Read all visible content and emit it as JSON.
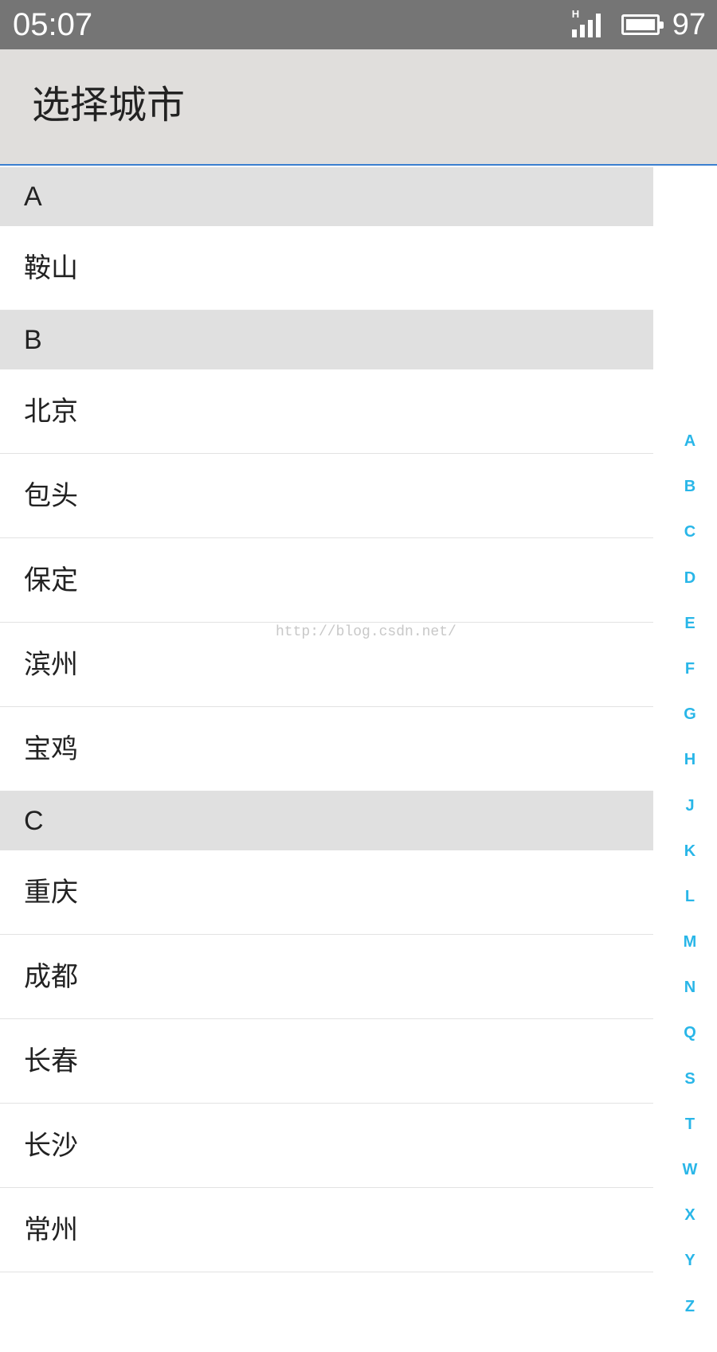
{
  "status_bar": {
    "time": "05:07",
    "network_label": "H",
    "battery_level": "97",
    "signal_icon": "signal-icon",
    "battery_icon": "battery-icon"
  },
  "title_bar": {
    "title": "选择城市",
    "accent_color": "#3b7fd0"
  },
  "city_list": {
    "sections": [
      {
        "letter": "A",
        "cities": [
          "鞍山"
        ]
      },
      {
        "letter": "B",
        "cities": [
          "北京",
          "包头",
          "保定",
          "滨州",
          "宝鸡"
        ]
      },
      {
        "letter": "C",
        "cities": [
          "重庆",
          "成都",
          "长春",
          "长沙",
          "常州"
        ]
      }
    ]
  },
  "index_bar": {
    "letters": [
      "A",
      "B",
      "C",
      "D",
      "E",
      "F",
      "G",
      "H",
      "J",
      "K",
      "L",
      "M",
      "N",
      "Q",
      "S",
      "T",
      "W",
      "X",
      "Y",
      "Z"
    ],
    "color": "#29b6e8"
  },
  "watermark": "http://blog.csdn.net/"
}
